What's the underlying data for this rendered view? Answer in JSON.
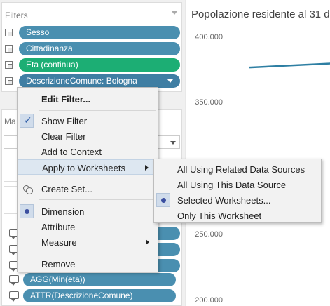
{
  "filters": {
    "title": "Filters",
    "pills": [
      {
        "label": "Sesso"
      },
      {
        "label": "Cittadinanza"
      },
      {
        "label": "Eta (continua)"
      },
      {
        "label": "DescrizioneComune: Bologna"
      }
    ]
  },
  "marks": {
    "title_partial": "Ma",
    "detail_pills": [
      {
        "label": "AGG(Min(eta))"
      },
      {
        "label": "ATTR(DescrizioneComune)"
      }
    ]
  },
  "chart": {
    "title": "Popolazione residente al 31 d",
    "y_ticks": [
      "400.000",
      "350.000",
      "250.000",
      "200.000"
    ]
  },
  "chart_data": {
    "type": "line",
    "title": "Popolazione residente al 31 d",
    "y_ticks": [
      "400.000",
      "350.000",
      "250.000",
      "200.000"
    ],
    "series": [
      {
        "values": [
          377000,
          380000
        ]
      }
    ]
  },
  "context_menu": {
    "items": {
      "edit_filter": "Edit Filter...",
      "show_filter": "Show Filter",
      "clear_filter": "Clear Filter",
      "add_to_context": "Add to Context",
      "apply_to_worksheets": "Apply to Worksheets",
      "create_set": "Create Set...",
      "dimension": "Dimension",
      "attribute": "Attribute",
      "measure": "Measure",
      "remove": "Remove"
    }
  },
  "submenu": {
    "items": [
      "All Using Related Data Sources",
      "All Using This Data Source",
      "Selected Worksheets...",
      "Only This Worksheet"
    ]
  },
  "colors": {
    "pill_blue": "#4a8fb0",
    "pill_green": "#1cae74",
    "line": "#2e7fa3"
  }
}
